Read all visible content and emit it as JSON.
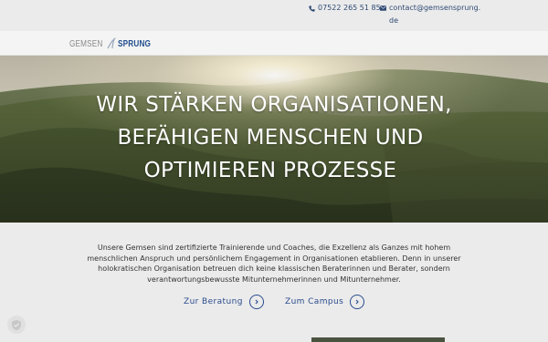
{
  "contact": {
    "phone": "07522 265 51 85",
    "email": "contact@gemsensprung.de",
    "phone_icon": "phone-icon",
    "email_icon": "mail-icon"
  },
  "logo": {
    "part1": "GEMSEN",
    "part2": "SPRUNG"
  },
  "hero": {
    "line1": "WIR STÄRKEN ORGANISATIONEN,",
    "line2": "BEFÄHIGEN MENSCHEN UND",
    "line3": "OPTIMIEREN PROZESSE"
  },
  "intro": {
    "text": "Unsere Gemsen sind zertifizierte Trainierende und Coaches, die Exzellenz als Ganzes mit hohem menschlichen Anspruch und persönlichem Engagement in Organisationen etablieren. Denn in unserer holokratischen Organisation betreuen dich keine klassischen Beraterinnen und Berater, sondern verantwortungsbewusste Mitunternehmerinnen und Mitunternehmer."
  },
  "links": {
    "beratung": "Zur Beratung",
    "campus": "Zum Campus"
  },
  "colors": {
    "brand_blue": "#1f4e8c",
    "link_blue": "#2a4c8e",
    "background": "#ebebeb"
  }
}
